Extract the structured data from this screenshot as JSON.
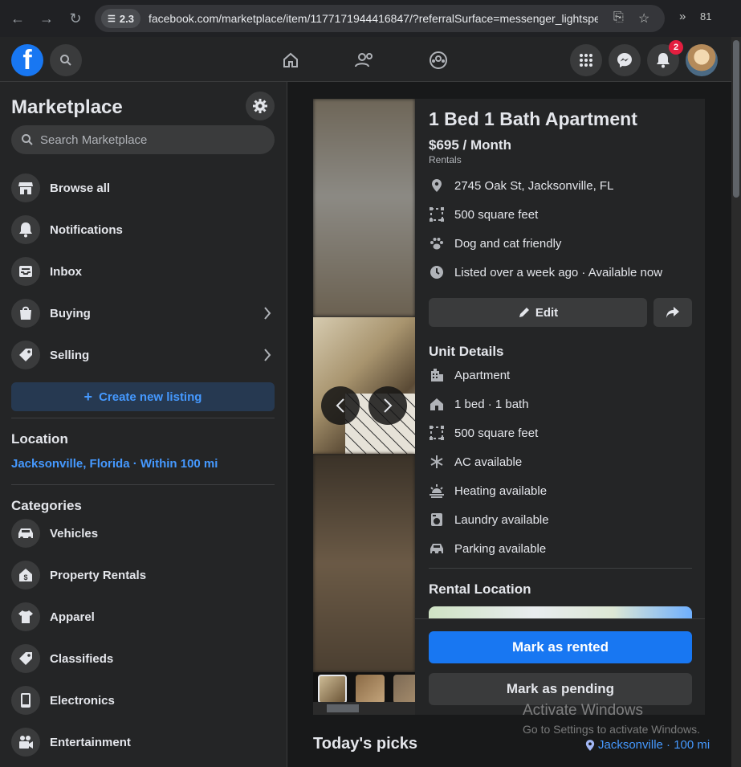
{
  "browser": {
    "site_chip": "2.3",
    "url": "facebook.com/marketplace/item/1177171944416847/?referralSurface=messenger_lightspe...",
    "extensions_count": "81"
  },
  "topnav": {
    "notification_count": "2"
  },
  "sidebar": {
    "title": "Marketplace",
    "search_placeholder": "Search Marketplace",
    "items": [
      {
        "label": "Browse all"
      },
      {
        "label": "Notifications"
      },
      {
        "label": "Inbox"
      },
      {
        "label": "Buying"
      },
      {
        "label": "Selling"
      }
    ],
    "create_label": "Create new listing",
    "location_heading": "Location",
    "location_value": "Jacksonville, Florida · Within 100 mi",
    "categories_heading": "Categories",
    "categories": [
      {
        "label": "Vehicles"
      },
      {
        "label": "Property Rentals"
      },
      {
        "label": "Apparel"
      },
      {
        "label": "Classifieds"
      },
      {
        "label": "Electronics"
      },
      {
        "label": "Entertainment"
      }
    ]
  },
  "listing": {
    "title": "1 Bed 1 Bath Apartment",
    "price": "$695 / Month",
    "category": "Rentals",
    "facts": [
      {
        "text": "2745 Oak St, Jacksonville, FL"
      },
      {
        "text": "500 square feet"
      },
      {
        "text": "Dog and cat friendly"
      },
      {
        "text": "Listed over a week ago · Available now"
      }
    ],
    "edit_label": "Edit",
    "unit_details_heading": "Unit Details",
    "unit_details": [
      {
        "text": "Apartment"
      },
      {
        "text": "1 bed · 1 bath"
      },
      {
        "text": "500 square feet"
      },
      {
        "text": "AC available"
      },
      {
        "text": "Heating available"
      },
      {
        "text": "Laundry available"
      },
      {
        "text": "Parking available"
      }
    ],
    "rental_location_heading": "Rental Location",
    "mark_rented_label": "Mark as rented",
    "mark_pending_label": "Mark as pending"
  },
  "picks": {
    "heading": "Today's picks",
    "location": "Jacksonville · 100 mi"
  },
  "watermark": {
    "line1": "Activate Windows",
    "line2": "Go to Settings to activate Windows."
  },
  "colors": {
    "accent": "#1877f2",
    "link": "#4599ff",
    "badge": "#e41e3f"
  }
}
